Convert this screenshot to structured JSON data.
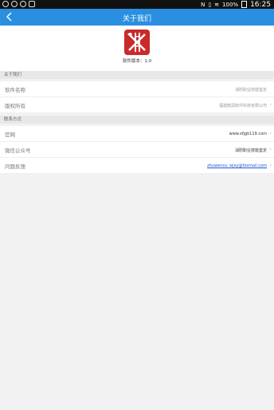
{
  "status_bar": {
    "battery": "100%",
    "time": "16:25"
  },
  "app_bar": {
    "title": "关于我们"
  },
  "header": {
    "version": "软件版本：1.0"
  },
  "sections": [
    {
      "title": "关于我们"
    },
    {
      "title": "联系方式"
    }
  ],
  "about": {
    "software_name_label": "软件名称",
    "software_name_value": "消防职业技能鉴定",
    "copyright_label": "版权所有",
    "copyright_value": "福建鼓润软件科技有限公司"
  },
  "contact": {
    "website_label": "官网",
    "website_value": "www.xfjgk119.com",
    "wechat_label": "微信公众号",
    "wechat_value": "消防职业技能鉴定",
    "feedback_label": "问题反馈",
    "feedback_value": "zhuwenxu_wjxy@foxmail.com"
  },
  "colors": {
    "accent": "#2a8fe0",
    "logo_red": "#c92a2a"
  }
}
